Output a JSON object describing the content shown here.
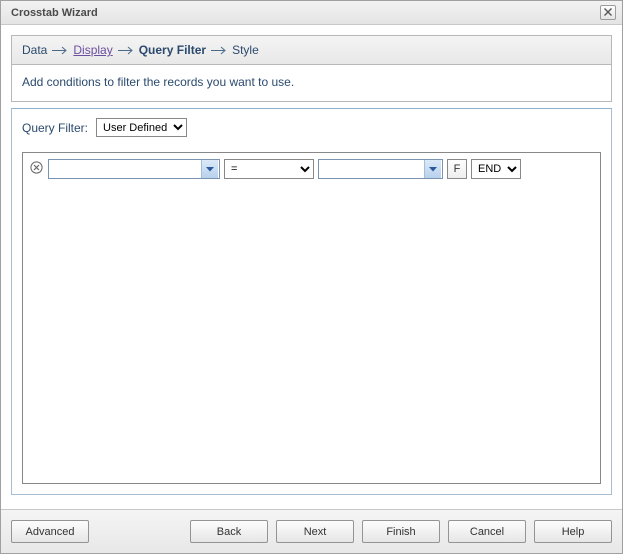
{
  "window": {
    "title": "Crosstab Wizard"
  },
  "breadcrumb": {
    "data": "Data",
    "display": "Display",
    "query_filter": "Query Filter",
    "style": "Style"
  },
  "instruction": "Add conditions to filter the records you want to use.",
  "filter": {
    "label": "Query Filter:",
    "type_value": "User Defined"
  },
  "row": {
    "field_value": "",
    "operator_value": "=",
    "value_value": "",
    "f_label": "F",
    "logic_value": "END"
  },
  "buttons": {
    "advanced": "Advanced",
    "back": "Back",
    "next": "Next",
    "finish": "Finish",
    "cancel": "Cancel",
    "help": "Help"
  }
}
